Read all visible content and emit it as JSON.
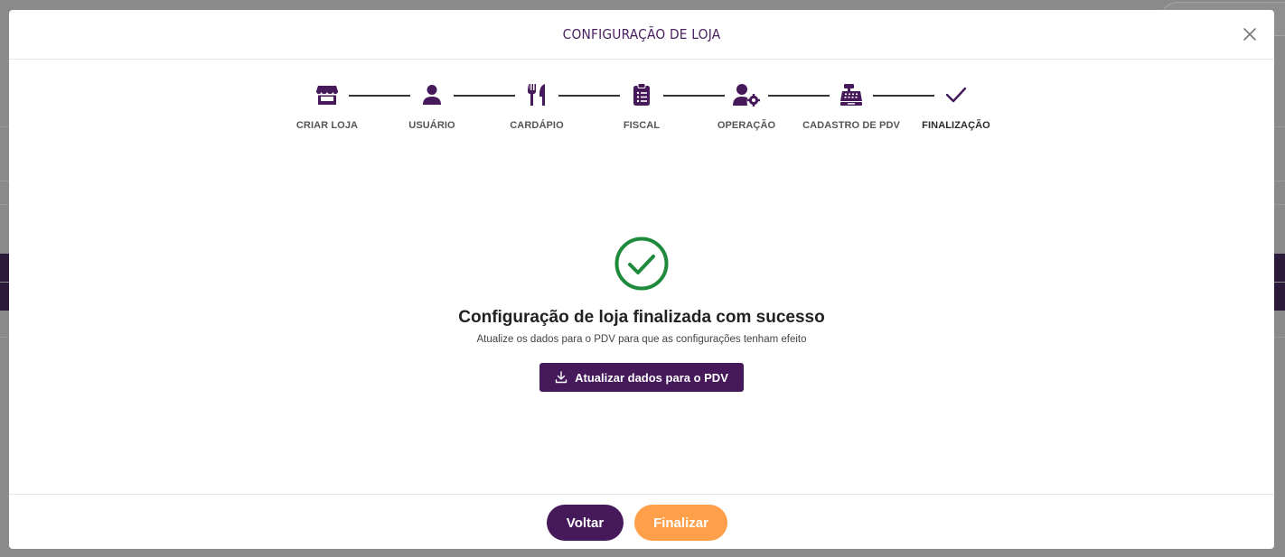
{
  "modal": {
    "title": "CONFIGURAÇÃO DE LOJA"
  },
  "stepper": {
    "steps": [
      {
        "label": "CRIAR LOJA",
        "icon": "store-icon"
      },
      {
        "label": "USUÁRIO",
        "icon": "user-icon"
      },
      {
        "label": "CARDÁPIO",
        "icon": "utensils-icon"
      },
      {
        "label": "FISCAL",
        "icon": "clipboard-list-icon"
      },
      {
        "label": "OPERAÇÃO",
        "icon": "user-cog-icon"
      },
      {
        "label": "CADASTRO DE PDV",
        "icon": "cash-register-icon"
      },
      {
        "label": "FINALIZAÇÃO",
        "icon": "check-icon"
      }
    ],
    "active_step": "FINALIZAÇÃO"
  },
  "success": {
    "title": "Configuração de loja finalizada com sucesso",
    "subtitle": "Atualize os dados para o PDV para que as configurações tenham efeito",
    "update_button": "Atualizar dados para o PDV"
  },
  "footer": {
    "back_label": "Voltar",
    "finish_label": "Finalizar"
  },
  "colors": {
    "primary": "#45195a",
    "accent": "#ff9f4a",
    "success": "#1e8a3c"
  }
}
